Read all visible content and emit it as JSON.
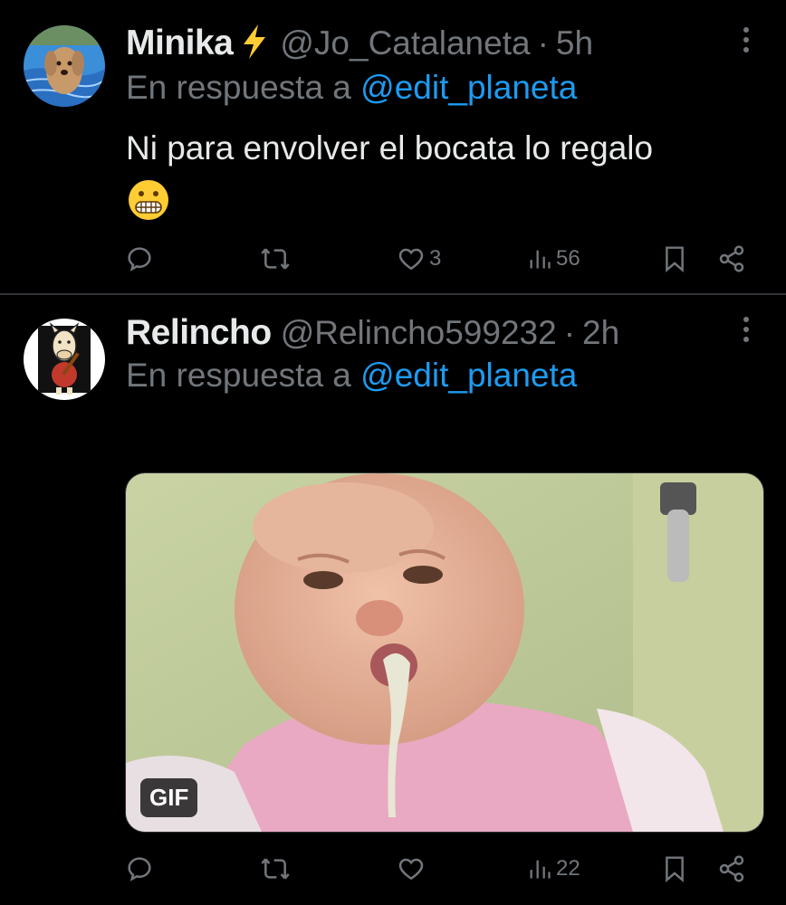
{
  "tweets": [
    {
      "name": "Minika",
      "handle": "@Jo_Catalaneta",
      "time": "5h",
      "reply_prefix": "En respuesta a",
      "reply_to": "@edit_planeta",
      "text": "Ni para envolver el bocata lo regalo",
      "emoji": "grimacing-face",
      "likes": "3",
      "views": "56",
      "avatar_icon": "dog-in-pool-avatar"
    },
    {
      "name": "Relincho",
      "handle": "@Relincho599232",
      "time": "2h",
      "reply_prefix": "En respuesta a",
      "reply_to": "@edit_planeta",
      "media_badge": "GIF",
      "views": "22",
      "avatar_icon": "horse-guitar-avatar"
    }
  ],
  "colors": {
    "background": "#000000",
    "text": "#e7e9ea",
    "muted": "#71767b",
    "link": "#1d9bf0",
    "divider": "#2f3336",
    "bolt": "#ffcc33"
  }
}
